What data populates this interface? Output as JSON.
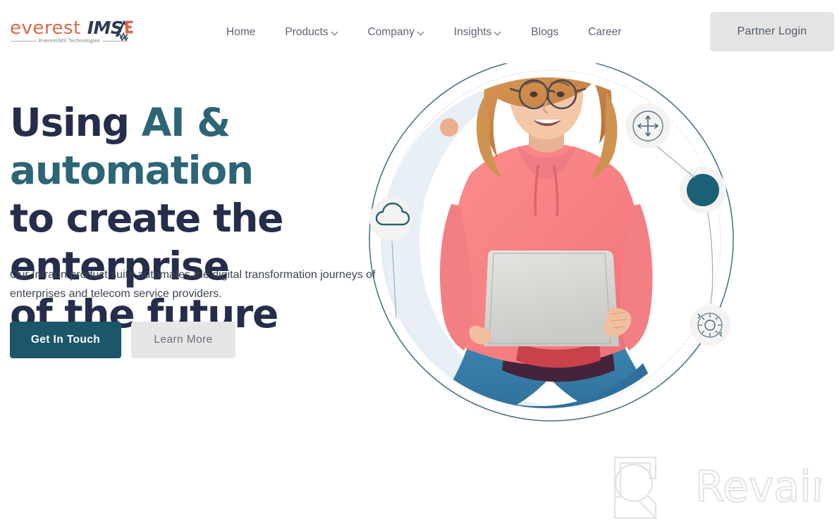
{
  "header": {
    "logo": {
      "brand_primary": "everest",
      "brand_secondary": "IMS",
      "tagline": "EverestIMS Technologies"
    },
    "nav_items": [
      {
        "label": "Home",
        "has_dropdown": false
      },
      {
        "label": "Products",
        "has_dropdown": true
      },
      {
        "label": "Company",
        "has_dropdown": true
      },
      {
        "label": "Insights",
        "has_dropdown": true
      },
      {
        "label": "Blogs",
        "has_dropdown": false
      },
      {
        "label": "Career",
        "has_dropdown": false
      }
    ],
    "partner_login_label": "Partner Login"
  },
  "hero": {
    "title_part1": "Using ",
    "title_accent": "AI & automation",
    "title_part2": " to create the enterprise of the future",
    "title_line1_plain": "Using ",
    "title_line1_accent": "AI & automation",
    "title_line2": "to create the enterprise",
    "title_line3": "of the future",
    "subtitle": "Our Infraon product suite automates the digital transformation journeys of enterprises and telecom service providers.",
    "primary_button": "Get In Touch",
    "secondary_button": "Learn More",
    "image_alt": "Smiling young woman with curly blonde hair and glasses, wearing a pink hoodie and blue jeans, sitting cross-legged holding an open laptop",
    "orbit_icons": [
      {
        "name": "move-arrows-icon"
      },
      {
        "name": "teal-dot-icon"
      },
      {
        "name": "gear-refresh-icon"
      },
      {
        "name": "cloud-icon"
      },
      {
        "name": "orange-dot-icon"
      }
    ]
  },
  "watermark": {
    "label": "Revain",
    "logo_name": "revain-logo-icon"
  },
  "colors": {
    "brand_orange": "#d9684a",
    "brand_navy": "#2b3a55",
    "heading_navy": "#252d4a",
    "accent_teal": "#2c6575",
    "button_teal": "#1b566a",
    "button_gray": "#e6e6e6",
    "nav_text": "#5c6472",
    "halo_blue": "#e8eff7",
    "orbit_line": "#2b5c6d",
    "orange_dot": "#e9b18e",
    "page_background": "#ffffff"
  }
}
